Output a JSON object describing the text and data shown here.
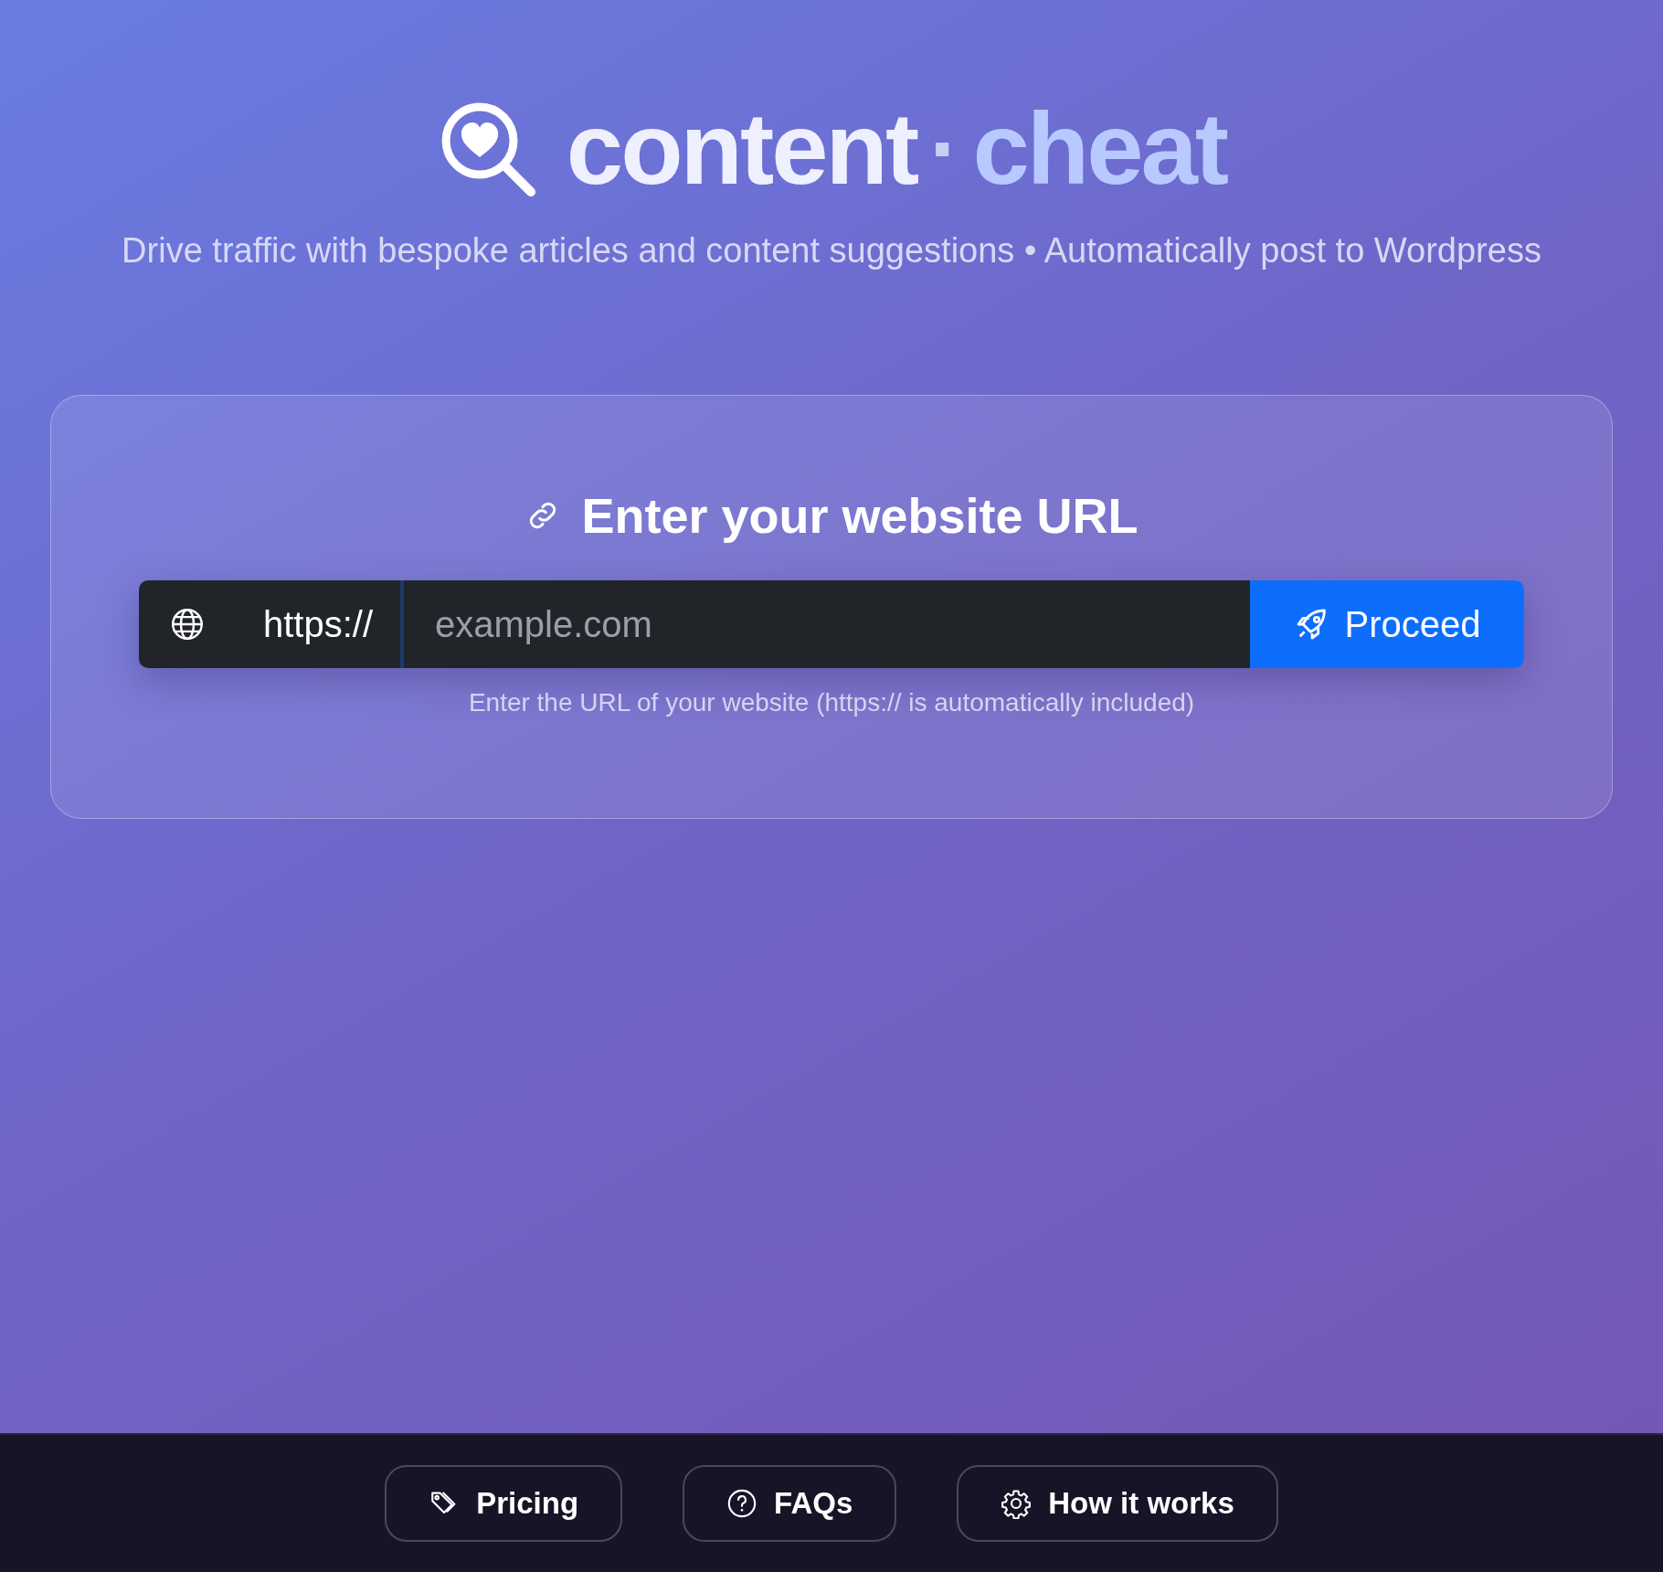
{
  "brand": {
    "word1": "content",
    "separator": "·",
    "word2": "cheat"
  },
  "tagline": "Drive traffic with bespoke articles and content suggestions • Automatically post to Wordpress",
  "card": {
    "heading": "Enter your website URL",
    "prefix": "https://",
    "placeholder": "example.com",
    "button": "Proceed",
    "hint": "Enter the URL of your website (https:// is automatically included)"
  },
  "footer": [
    {
      "kind": "tag",
      "label": "Pricing"
    },
    {
      "kind": "question",
      "label": "FAQs"
    },
    {
      "kind": "gear",
      "label": "How it works"
    }
  ]
}
